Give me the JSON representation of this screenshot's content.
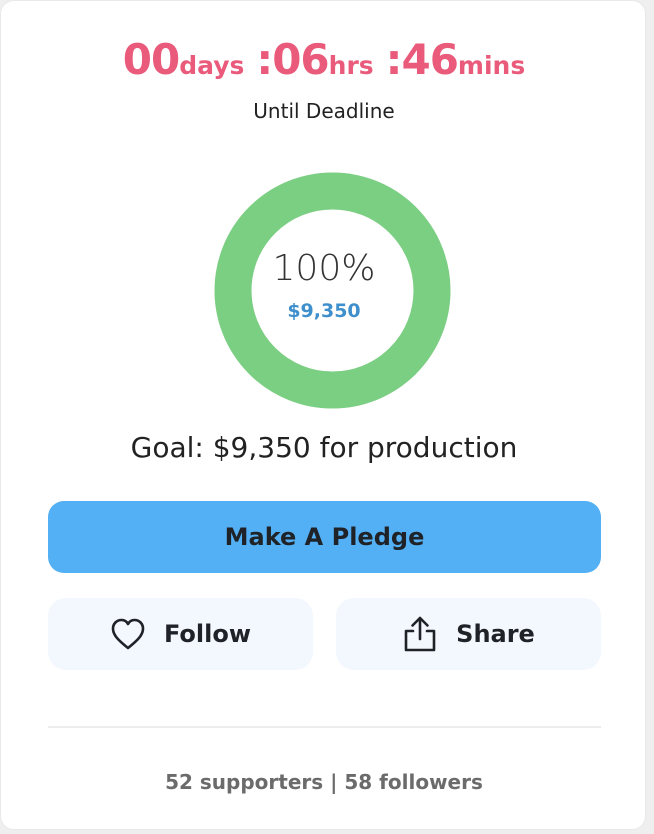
{
  "countdown": {
    "days_value": "00",
    "days_unit": "days",
    "hours_value": ":06",
    "hours_unit": "hrs",
    "mins_value": ":46",
    "mins_unit": "mins",
    "caption": "Until Deadline"
  },
  "progress": {
    "percent_label": "100%",
    "raised": "$9,350",
    "fraction": 1.0,
    "ring_color": "#7bcf82"
  },
  "goal_text": "Goal: $9,350 for production",
  "actions": {
    "pledge_label": "Make A Pledge",
    "follow_label": "Follow",
    "follow_icon": "heart-icon",
    "share_label": "Share",
    "share_icon": "share-icon"
  },
  "stats_text": "52 supporters | 58 followers",
  "colors": {
    "accent_pink": "#e95a7b",
    "pledge_blue": "#53b0f4",
    "raised_blue": "#3e8fcb"
  }
}
